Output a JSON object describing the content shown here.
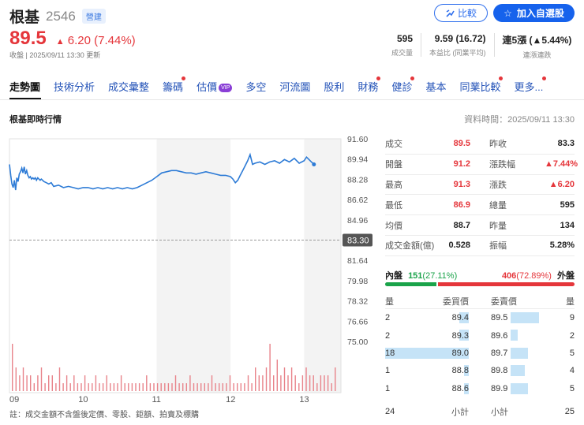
{
  "header": {
    "name": "根基",
    "code": "2546",
    "tag": "營建",
    "compare_label": "比較",
    "add_watchlist_label": "加入自選股",
    "price": "89.5",
    "change": "6.20 (7.44%)",
    "status": "收盤 | 2025/09/11 13:30 更新",
    "stats": [
      {
        "value": "595",
        "label": "成交量"
      },
      {
        "value": "9.59 (16.72)",
        "label": "本益比 (同業平均)"
      },
      {
        "value": "連5漲 (▲5.44%)",
        "label": "連漲連跌"
      }
    ]
  },
  "tabs": [
    {
      "label": "走勢圖",
      "active": true,
      "dot": false
    },
    {
      "label": "技術分析",
      "dot": false
    },
    {
      "label": "成交彙整",
      "dot": false
    },
    {
      "label": "籌碼",
      "dot": true
    },
    {
      "label": "估價",
      "dot": false,
      "vip": "VIP"
    },
    {
      "label": "多空",
      "dot": false
    },
    {
      "label": "河流圖",
      "dot": false
    },
    {
      "label": "股利",
      "dot": false
    },
    {
      "label": "財務",
      "dot": true
    },
    {
      "label": "健診",
      "dot": true
    },
    {
      "label": "基本",
      "dot": false
    },
    {
      "label": "同業比較",
      "dot": true
    },
    {
      "label": "更多",
      "dot": true
    }
  ],
  "section": {
    "title": "根基即時行情",
    "data_time": "資料時間：2025/09/11 13:30"
  },
  "chart_data": {
    "type": "line",
    "y_ticks": [
      "91.60",
      "89.94",
      "88.28",
      "86.62",
      "84.96",
      "83.30",
      "81.64",
      "79.98",
      "78.32",
      "76.66",
      "75.00"
    ],
    "ylim": [
      75.0,
      91.6
    ],
    "ref_price": "83.30",
    "x_ticks": [
      "09",
      "10",
      "11",
      "12",
      "13"
    ],
    "price_series": [
      [
        0,
        89.5
      ],
      [
        1,
        88.6
      ],
      [
        2,
        87.9
      ],
      [
        3,
        87.6
      ],
      [
        4,
        88.2
      ],
      [
        5,
        87.4
      ],
      [
        6,
        88.4
      ],
      [
        7,
        88.1
      ],
      [
        8,
        88.7
      ],
      [
        9,
        88.9
      ],
      [
        10,
        89.2
      ],
      [
        11,
        88.8
      ],
      [
        12,
        89.3
      ],
      [
        13,
        88.7
      ],
      [
        14,
        89.0
      ],
      [
        15,
        88.6
      ],
      [
        16,
        88.4
      ],
      [
        17,
        88.5
      ],
      [
        18,
        88.3
      ],
      [
        19,
        88.4
      ],
      [
        20,
        88.3
      ],
      [
        21,
        88.4
      ],
      [
        22,
        88.2
      ],
      [
        23,
        88.4
      ],
      [
        24,
        88.3
      ],
      [
        25,
        88.2
      ],
      [
        26,
        88.3
      ],
      [
        28,
        88.1
      ],
      [
        30,
        88.0
      ],
      [
        32,
        87.9
      ],
      [
        34,
        88.0
      ],
      [
        36,
        87.7
      ],
      [
        40,
        87.8
      ],
      [
        44,
        87.6
      ],
      [
        48,
        87.7
      ],
      [
        52,
        87.6
      ],
      [
        56,
        87.5
      ],
      [
        60,
        87.6
      ],
      [
        64,
        87.6
      ],
      [
        68,
        87.5
      ],
      [
        72,
        87.6
      ],
      [
        76,
        87.5
      ],
      [
        80,
        87.6
      ],
      [
        84,
        87.5
      ],
      [
        88,
        87.6
      ],
      [
        92,
        87.5
      ],
      [
        96,
        87.6
      ],
      [
        100,
        87.5
      ],
      [
        104,
        87.6
      ],
      [
        108,
        87.8
      ],
      [
        112,
        88.0
      ],
      [
        116,
        88.2
      ],
      [
        120,
        88.5
      ],
      [
        124,
        88.8
      ],
      [
        128,
        88.9
      ],
      [
        132,
        89.0
      ],
      [
        136,
        89.0
      ],
      [
        140,
        88.9
      ],
      [
        144,
        88.8
      ],
      [
        148,
        88.8
      ],
      [
        152,
        88.7
      ],
      [
        156,
        88.8
      ],
      [
        160,
        88.9
      ],
      [
        164,
        88.8
      ],
      [
        168,
        88.7
      ],
      [
        172,
        88.6
      ],
      [
        176,
        88.6
      ],
      [
        180,
        88.5
      ],
      [
        182,
        88.3
      ],
      [
        184,
        88.0
      ],
      [
        186,
        88.2
      ],
      [
        188,
        88.6
      ],
      [
        190,
        89.0
      ],
      [
        192,
        89.4
      ],
      [
        194,
        89.8
      ],
      [
        196,
        90.3
      ],
      [
        198,
        89.5
      ],
      [
        200,
        89.6
      ],
      [
        204,
        89.7
      ],
      [
        208,
        89.5
      ],
      [
        212,
        89.7
      ],
      [
        216,
        89.8
      ],
      [
        220,
        89.6
      ],
      [
        224,
        89.9
      ],
      [
        228,
        89.7
      ],
      [
        232,
        90.0
      ],
      [
        236,
        89.6
      ],
      [
        240,
        89.8
      ],
      [
        242,
        90.1
      ],
      [
        245,
        89.8
      ],
      [
        248,
        89.5
      ]
    ],
    "volume_series": [
      6,
      3,
      2,
      3,
      2,
      2,
      1,
      2,
      3,
      1,
      2,
      2,
      1,
      3,
      1,
      2,
      1,
      2,
      1,
      1,
      2,
      1,
      1,
      2,
      1,
      1,
      2,
      1,
      1,
      1,
      2,
      1,
      1,
      1,
      1,
      1,
      1,
      2,
      1,
      1,
      1,
      1,
      1,
      1,
      1,
      2,
      1,
      1,
      1,
      2,
      1,
      1,
      1,
      1,
      1,
      2,
      1,
      1,
      1,
      1,
      2,
      1,
      1,
      1,
      1,
      2,
      1,
      3,
      2,
      2,
      3,
      6,
      2,
      4,
      2,
      3,
      2,
      3,
      2,
      1,
      2,
      3,
      2,
      2,
      1,
      2,
      2,
      2,
      1,
      3
    ],
    "grid": true
  },
  "quote": {
    "left": [
      {
        "label": "成交",
        "value": "89.5",
        "color": "up"
      },
      {
        "label": "開盤",
        "value": "91.2",
        "color": "up"
      },
      {
        "label": "最高",
        "value": "91.3",
        "color": "up"
      },
      {
        "label": "最低",
        "value": "86.9",
        "color": "up"
      },
      {
        "label": "均價",
        "value": "88.7",
        "color": "plain"
      },
      {
        "label": "成交金額(億)",
        "value": "0.528",
        "color": "plain"
      }
    ],
    "right": [
      {
        "label": "昨收",
        "value": "83.3",
        "color": "plain"
      },
      {
        "label": "漲跌幅",
        "value": "▲7.44%",
        "color": "up"
      },
      {
        "label": "漲跌",
        "value": "▲6.20",
        "color": "up"
      },
      {
        "label": "總量",
        "value": "595",
        "color": "plain"
      },
      {
        "label": "昨量",
        "value": "134",
        "color": "plain"
      },
      {
        "label": "振幅",
        "value": "5.28%",
        "color": "plain"
      }
    ]
  },
  "inout": {
    "inner_label": "內盤",
    "inner_value": "151",
    "inner_pct": "(27.11%)",
    "outer_value": "406",
    "outer_pct": "(72.89%)",
    "outer_label": "外盤",
    "inner_fraction": 0.2711,
    "green": "#1aa34a",
    "red": "#e5363b"
  },
  "orderbook": {
    "headers": [
      "量",
      "委買價",
      "委賣價",
      "量"
    ],
    "rows": [
      {
        "bid_qty": "2",
        "bid_price": "89.4",
        "ask_price": "89.5",
        "ask_qty": "9",
        "bid_frac": 0.11,
        "ask_frac": 0.9
      },
      {
        "bid_qty": "2",
        "bid_price": "89.3",
        "ask_price": "89.6",
        "ask_qty": "2",
        "bid_frac": 0.11,
        "ask_frac": 0.22
      },
      {
        "bid_qty": "18",
        "bid_price": "89.0",
        "ask_price": "89.7",
        "ask_qty": "5",
        "bid_frac": 1.0,
        "ask_frac": 0.55
      },
      {
        "bid_qty": "1",
        "bid_price": "88.8",
        "ask_price": "89.8",
        "ask_qty": "4",
        "bid_frac": 0.06,
        "ask_frac": 0.44
      },
      {
        "bid_qty": "1",
        "bid_price": "88.6",
        "ask_price": "89.9",
        "ask_qty": "5",
        "bid_frac": 0.06,
        "ask_frac": 0.55
      }
    ],
    "footer": {
      "bid_total": "24",
      "bid_label": "小計",
      "ask_label": "小計",
      "ask_total": "25"
    }
  },
  "footnote": "註：成交金額不含盤後定價、零股、鉅額、拍賣及標購"
}
